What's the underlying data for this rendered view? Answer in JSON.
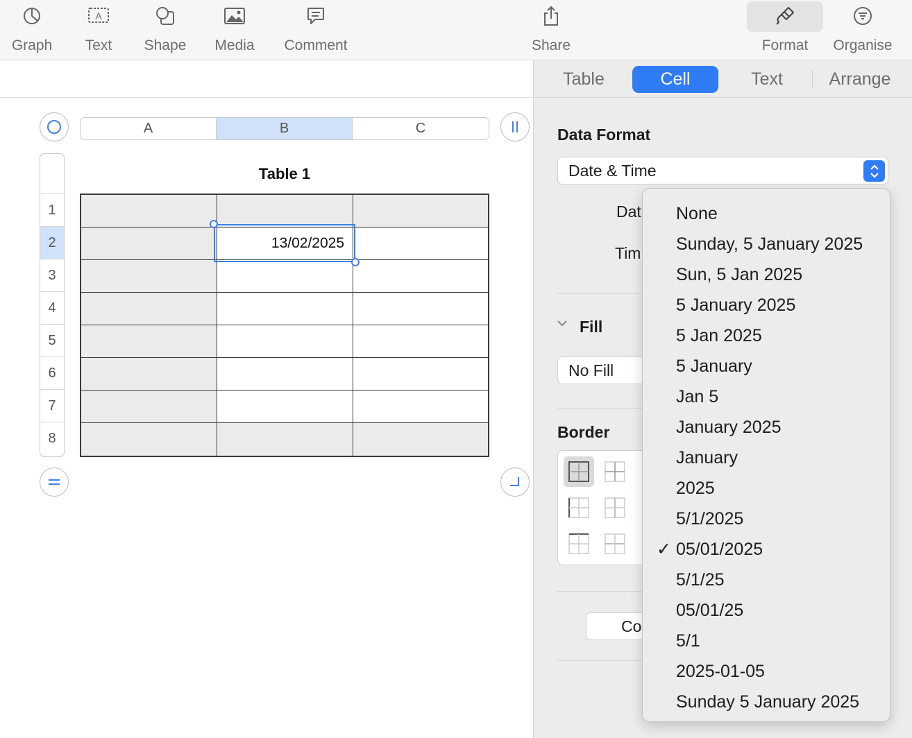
{
  "toolbar": {
    "graph": "Graph",
    "text": "Text",
    "shape": "Shape",
    "media": "Media",
    "comment": "Comment",
    "share": "Share",
    "format": "Format",
    "organise": "Organise"
  },
  "table": {
    "title": "Table 1",
    "columns": [
      "A",
      "B",
      "C"
    ],
    "selected_column": "B",
    "rows": [
      "1",
      "2",
      "3",
      "4",
      "5",
      "6",
      "7",
      "8"
    ],
    "selected_row": "2",
    "selected_cell_value": "13/02/2025"
  },
  "inspector": {
    "tabs": [
      "Table",
      "Cell",
      "Text",
      "Arrange"
    ],
    "active_tab": "Cell",
    "data_format_title": "Data Format",
    "data_format_value": "Date & Time",
    "date_label_partial": "Dat",
    "time_label_partial": "Tim",
    "fill_title": "Fill",
    "fill_value": "No Fill",
    "border_title": "Border",
    "button_partial": "Co"
  },
  "date_menu": {
    "items": [
      "None",
      "Sunday, 5 January 2025",
      "Sun, 5 Jan 2025",
      "5 January 2025",
      "5 Jan 2025",
      "5 January",
      "Jan 5",
      "January 2025",
      "January",
      "2025",
      "5/1/2025",
      "05/01/2025",
      "5/1/25",
      "05/01/25",
      "5/1",
      "2025-01-05",
      "Sunday 5 January 2025"
    ],
    "selected_index": 11,
    "check_mark": "✓"
  },
  "colors": {
    "accent": "#2f7cf6",
    "selection_fill": "#cfe2fa",
    "header_cell": "#ebebeb"
  }
}
